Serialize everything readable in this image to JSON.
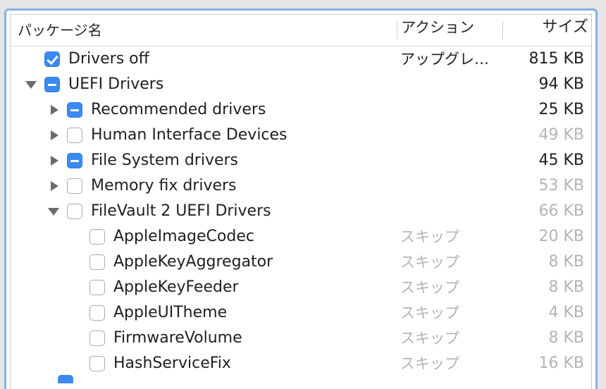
{
  "header": {
    "name": "パッケージ名",
    "action": "アクション",
    "size": "サイズ"
  },
  "rows": [
    {
      "label": "Drivers off",
      "action": "アップグレ…",
      "size": "815 KB",
      "check": "checked",
      "expand": "none",
      "level": 0,
      "dim": false
    },
    {
      "label": "UEFI Drivers",
      "action": "",
      "size": "94 KB",
      "check": "mixed",
      "expand": "down",
      "level": 0,
      "dim": false
    },
    {
      "label": "Recommended drivers",
      "action": "",
      "size": "25 KB",
      "check": "mixed",
      "expand": "right",
      "level": 1,
      "dim": false
    },
    {
      "label": "Human Interface Devices",
      "action": "",
      "size": "49 KB",
      "check": "unchecked",
      "expand": "right",
      "level": 1,
      "dim": true
    },
    {
      "label": "File System drivers",
      "action": "",
      "size": "45 KB",
      "check": "mixed",
      "expand": "right",
      "level": 1,
      "dim": false
    },
    {
      "label": "Memory fix drivers",
      "action": "",
      "size": "53 KB",
      "check": "unchecked",
      "expand": "right",
      "level": 1,
      "dim": true
    },
    {
      "label": "FileVault 2 UEFI Drivers",
      "action": "",
      "size": "66 KB",
      "check": "unchecked",
      "expand": "down",
      "level": 1,
      "dim": true
    },
    {
      "label": "AppleImageCodec",
      "action": "スキップ",
      "size": "20 KB",
      "check": "unchecked",
      "expand": "none",
      "level": 2,
      "dim": true
    },
    {
      "label": "AppleKeyAggregator",
      "action": "スキップ",
      "size": "8 KB",
      "check": "unchecked",
      "expand": "none",
      "level": 2,
      "dim": true
    },
    {
      "label": "AppleKeyFeeder",
      "action": "スキップ",
      "size": "8 KB",
      "check": "unchecked",
      "expand": "none",
      "level": 2,
      "dim": true
    },
    {
      "label": "AppleUITheme",
      "action": "スキップ",
      "size": "4 KB",
      "check": "unchecked",
      "expand": "none",
      "level": 2,
      "dim": true
    },
    {
      "label": "FirmwareVolume",
      "action": "スキップ",
      "size": "8 KB",
      "check": "unchecked",
      "expand": "none",
      "level": 2,
      "dim": true
    },
    {
      "label": "HashServiceFix",
      "action": "スキップ",
      "size": "16 KB",
      "check": "unchecked",
      "expand": "none",
      "level": 2,
      "dim": true
    }
  ],
  "colors": {
    "accent": "#3b8af1",
    "focus_ring": "#88b0ea",
    "dim_text": "#b4b4b4"
  }
}
